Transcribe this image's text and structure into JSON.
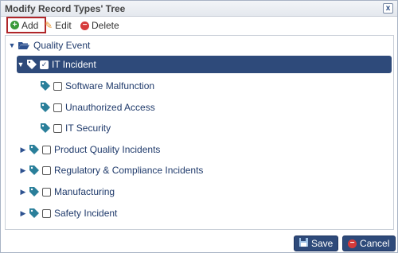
{
  "window": {
    "title": "Modify Record Types' Tree",
    "close_glyph": "x"
  },
  "toolbar": {
    "add_label": "Add",
    "edit_label": "Edit",
    "delete_label": "Delete"
  },
  "tree": {
    "root": "Quality Event",
    "selected": "IT Incident",
    "children_of_selected": [
      "Software Malfunction",
      "Unauthorized Access",
      "IT Security"
    ],
    "siblings": [
      "Product Quality Incidents",
      "Regulatory & Compliance Incidents",
      "Manufacturing",
      "Safety Incident"
    ]
  },
  "footer": {
    "save_label": "Save",
    "cancel_label": "Cancel"
  },
  "colors": {
    "accent": "#2e4a7a",
    "add_border": "#b0262a",
    "tag": "#2a7f9a"
  }
}
